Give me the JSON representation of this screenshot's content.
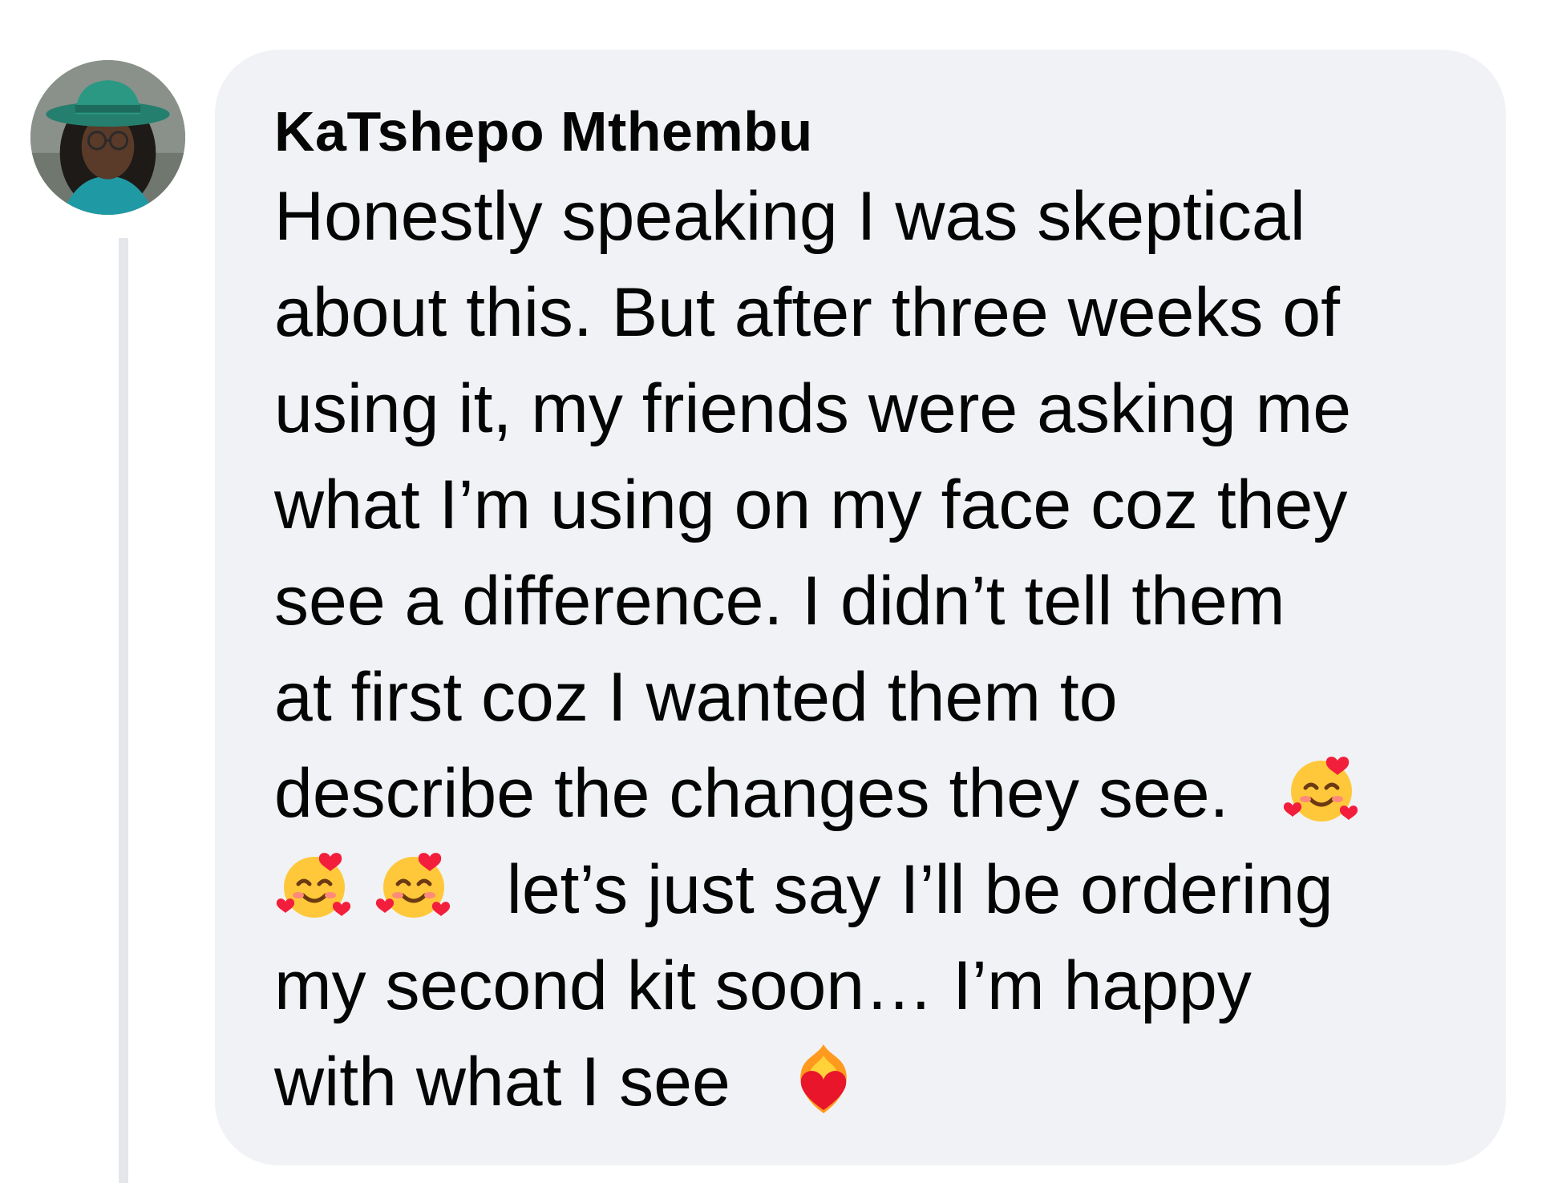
{
  "comment": {
    "author": "KaTshepo Mthembu",
    "lines": [
      "Honestly speaking I was skeptical",
      "about this. But after three weeks of",
      "using it, my friends were asking me",
      "what I’m using on my face coz they",
      "see a difference. I didn’t tell them",
      "at first coz I wanted them to",
      "describe the changes they see.",
      "let’s just say I’ll be ordering",
      "my second kit soon… I’m happy",
      "with what I see"
    ],
    "emojis": {
      "smiling_hearts": "🥰",
      "heart_on_fire": "❤️‍🔥"
    }
  },
  "icons": {
    "avatar": "profile-photo-woman-green-hat",
    "emoji_1": "smiling-face-with-hearts-icon",
    "emoji_2": "heart-on-fire-icon"
  }
}
